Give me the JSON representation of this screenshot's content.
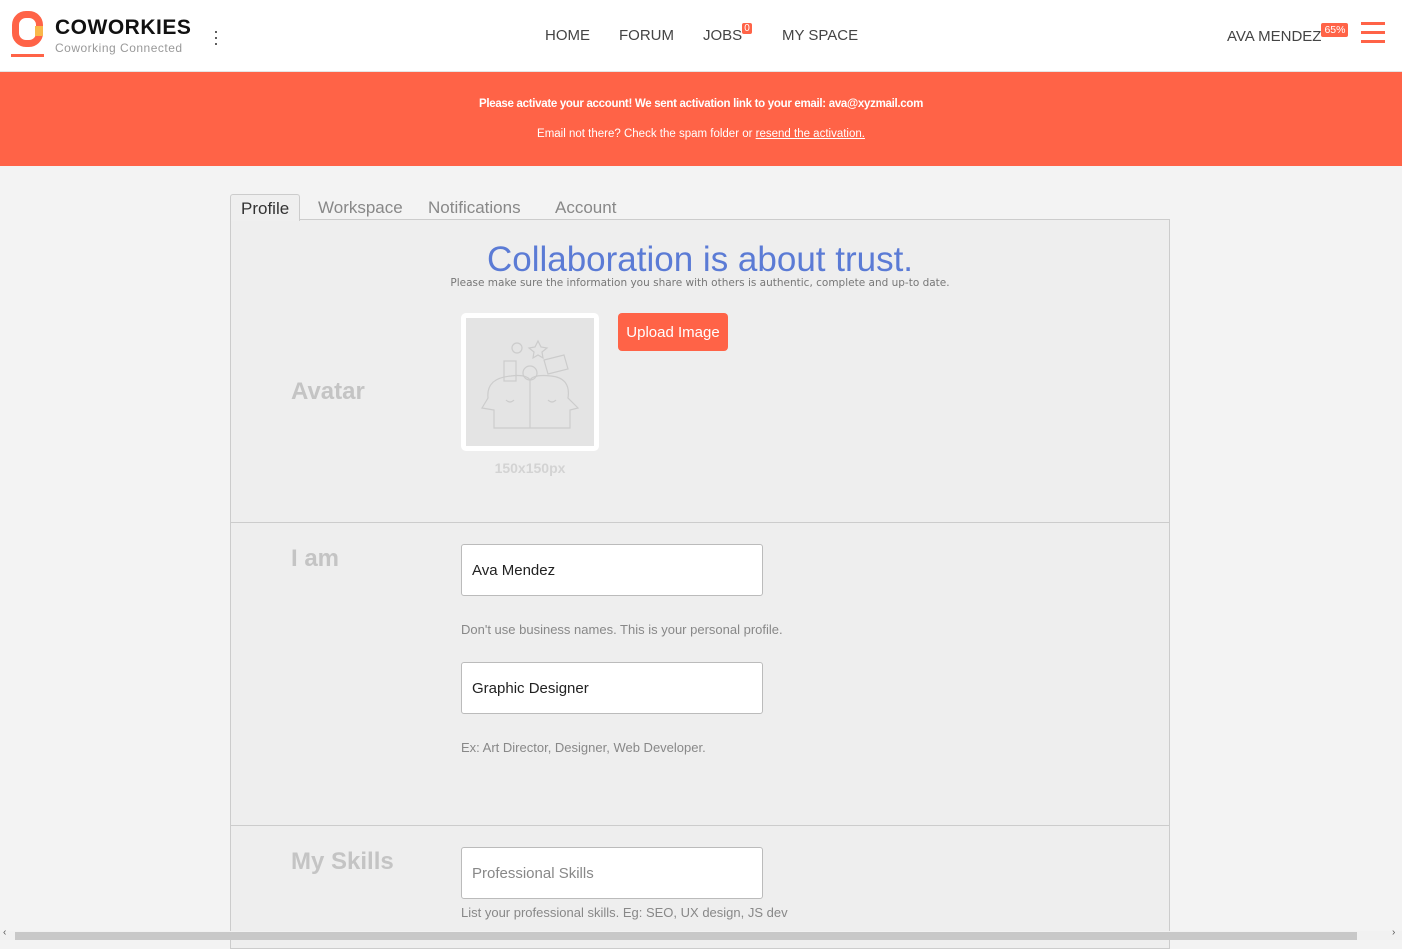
{
  "header": {
    "brand": "COWORKIES",
    "tagline": "Coworking Connected",
    "nav": [
      {
        "label": "HOME"
      },
      {
        "label": "FORUM"
      },
      {
        "label": "JOBS",
        "badge": "0"
      },
      {
        "label": "MY SPACE"
      }
    ],
    "user": {
      "name": "AVA MENDEZ",
      "completion": "65%"
    },
    "accent": "#ff6347"
  },
  "alert": {
    "line1": "Please activate your account! We sent activation link to your email: ava@xyzmail.com",
    "line2": "Email not there? Check the spam folder or ",
    "link": "resend the activation."
  },
  "tabs": [
    {
      "label": "Profile",
      "active": true
    },
    {
      "label": "Workspace"
    },
    {
      "label": "Notifications"
    },
    {
      "label": "Account"
    }
  ],
  "profile": {
    "headline": "Collaboration is about trust.",
    "subline": "Please make sure the information you share with others is authentic, complete and up-to date.",
    "avatar": {
      "label": "Avatar",
      "upload": "Upload Image",
      "size": "150x150px"
    },
    "iam": {
      "label": "I am",
      "name_value": "Ava Mendez",
      "name_hint": "Don't use business names. This is your personal profile.",
      "title_value": "Graphic Designer",
      "title_hint": "Ex: Art Director, Designer, Web Developer."
    },
    "skills": {
      "label": "My Skills",
      "placeholder": "Professional Skills",
      "hint": "List your professional skills. Eg: SEO, UX design, JS dev"
    }
  }
}
